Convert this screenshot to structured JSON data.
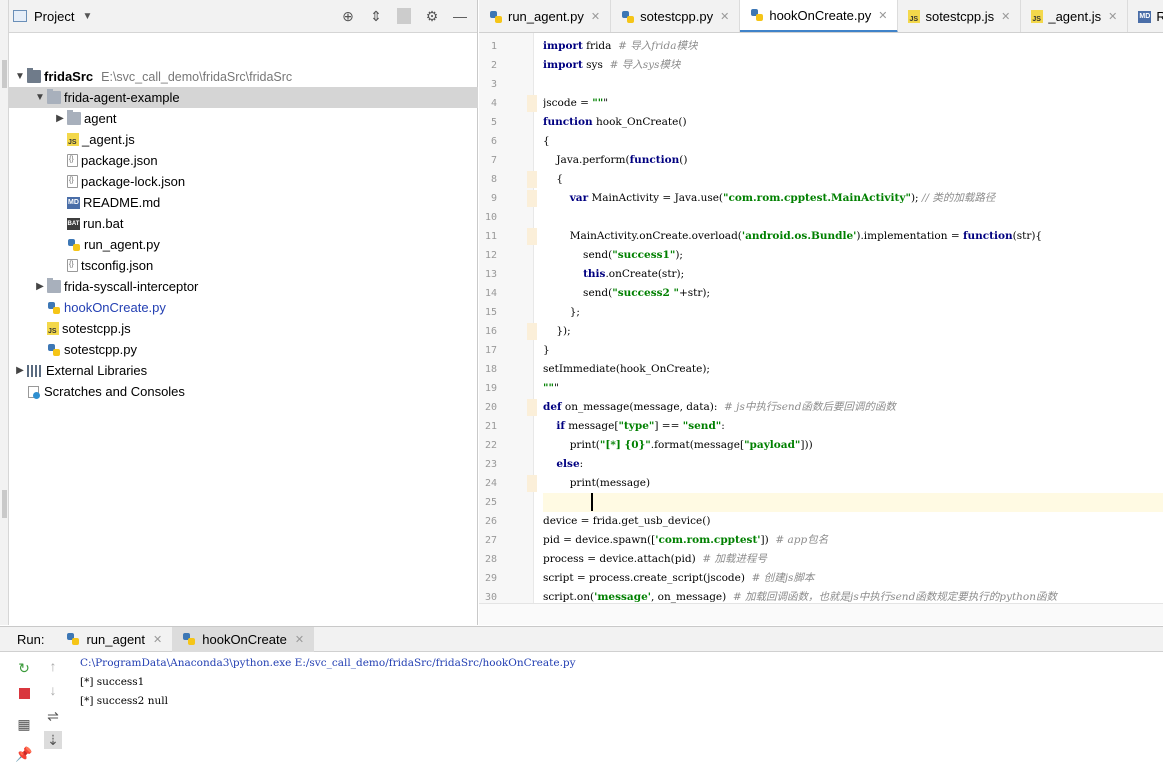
{
  "project": {
    "header_title": "Project",
    "tree": [
      {
        "label": "fridaSrc",
        "path": "E:\\svc_call_demo\\fridaSrc\\fridaSrc",
        "icon": "folder-icon",
        "depth": 0,
        "expanded": true,
        "bold": true
      },
      {
        "label": "frida-agent-example",
        "icon": "folder-icon",
        "depth": 1,
        "expanded": true,
        "selected": true
      },
      {
        "label": "agent",
        "icon": "folder-icon",
        "depth": 2,
        "expanded": false
      },
      {
        "label": "_agent.js",
        "icon": "js-file-icon",
        "depth": 2
      },
      {
        "label": "package.json",
        "icon": "json-file-icon",
        "depth": 2
      },
      {
        "label": "package-lock.json",
        "icon": "json-file-icon",
        "depth": 2
      },
      {
        "label": "README.md",
        "icon": "md-file-icon",
        "depth": 2
      },
      {
        "label": "run.bat",
        "icon": "bat-file-icon",
        "depth": 2
      },
      {
        "label": "run_agent.py",
        "icon": "python-file-icon",
        "depth": 2
      },
      {
        "label": "tsconfig.json",
        "icon": "json-file-icon",
        "depth": 2
      },
      {
        "label": "frida-syscall-interceptor",
        "icon": "folder-icon",
        "depth": 1,
        "expanded": false
      },
      {
        "label": "hookOnCreate.py",
        "icon": "python-file-icon",
        "depth": 1,
        "active": true
      },
      {
        "label": "sotestcpp.js",
        "icon": "js-file-icon",
        "depth": 1
      },
      {
        "label": "sotestcpp.py",
        "icon": "python-file-icon",
        "depth": 1
      },
      {
        "label": "External Libraries",
        "icon": "library-icon",
        "depth": 0,
        "expanded": false
      },
      {
        "label": "Scratches and Consoles",
        "icon": "scratches-icon",
        "depth": 0
      }
    ]
  },
  "editor": {
    "tabs": [
      {
        "label": "run_agent.py",
        "icon": "python-file-icon"
      },
      {
        "label": "sotestcpp.py",
        "icon": "python-file-icon"
      },
      {
        "label": "hookOnCreate.py",
        "icon": "python-file-icon",
        "active": true
      },
      {
        "label": "sotestcpp.js",
        "icon": "js-file-icon"
      },
      {
        "label": "_agent.js",
        "icon": "js-file-icon"
      },
      {
        "label": "README",
        "icon": "md-file-icon"
      }
    ],
    "lines": [
      {
        "n": "1",
        "code": "import frida  # 导入frida模块"
      },
      {
        "n": "2",
        "code": "import sys  # 导入sys模块"
      },
      {
        "n": "3",
        "code": ""
      },
      {
        "n": "4",
        "code": "jscode = \"\"\""
      },
      {
        "n": "5",
        "code": "function hook_OnCreate()"
      },
      {
        "n": "6",
        "code": "{"
      },
      {
        "n": "7",
        "code": "    Java.perform(function()"
      },
      {
        "n": "8",
        "code": "    {"
      },
      {
        "n": "9",
        "code": "        var MainActivity = Java.use(\"com.rom.cpptest.MainActivity\"); // 类的加载路径"
      },
      {
        "n": "10",
        "code": ""
      },
      {
        "n": "11",
        "code": "        MainActivity.onCreate.overload('android.os.Bundle').implementation = function(str){"
      },
      {
        "n": "12",
        "code": "            send(\"success1\");"
      },
      {
        "n": "13",
        "code": "            this.onCreate(str);"
      },
      {
        "n": "14",
        "code": "            send(\"success2 \"+str);"
      },
      {
        "n": "15",
        "code": "        };"
      },
      {
        "n": "16",
        "code": "    });"
      },
      {
        "n": "17",
        "code": "}"
      },
      {
        "n": "18",
        "code": "setImmediate(hook_OnCreate);"
      },
      {
        "n": "19",
        "code": "\"\"\""
      },
      {
        "n": "20",
        "code": "def on_message(message, data):  # js中执行send函数后要回调的函数"
      },
      {
        "n": "21",
        "code": "    if message[\"type\"] == \"send\":"
      },
      {
        "n": "22",
        "code": "        print(\"[*] {0}\".format(message[\"payload\"]))"
      },
      {
        "n": "23",
        "code": "    else:"
      },
      {
        "n": "24",
        "code": "        print(message)"
      },
      {
        "n": "25",
        "code": ""
      },
      {
        "n": "26",
        "code": "device = frida.get_usb_device()"
      },
      {
        "n": "27",
        "code": "pid = device.spawn(['com.rom.cpptest'])  # app包名"
      },
      {
        "n": "28",
        "code": "process = device.attach(pid)  # 加载进程号"
      },
      {
        "n": "29",
        "code": "script = process.create_script(jscode)  # 创建js脚本"
      },
      {
        "n": "30",
        "code": "script.on('message', on_message)  # 加载回调函数，也就是js中执行send函数规定要执行的python函数"
      }
    ]
  },
  "run": {
    "label": "Run:",
    "tabs": [
      {
        "label": "run_agent",
        "icon": "python-file-icon"
      },
      {
        "label": "hookOnCreate",
        "icon": "python-file-icon",
        "active": true
      }
    ],
    "output": [
      "C:\\ProgramData\\Anaconda3\\python.exe E:/svc_call_demo/fridaSrc/fridaSrc/hookOnCreate.py",
      "[*] success1",
      "[*] success2 null"
    ],
    "toolbar": [
      {
        "icon": "rerun-icon"
      },
      {
        "icon": "up-arrow-icon"
      },
      {
        "icon": "stop-icon"
      },
      {
        "icon": "down-arrow-icon"
      },
      {
        "icon": "soft-wrap-icon"
      },
      {
        "icon": "layout-icon"
      },
      {
        "icon": "scroll-end-icon"
      },
      {
        "icon": "pin-icon"
      }
    ]
  },
  "colors": {
    "accent": "#4083c9",
    "selection": "#d5d5d5",
    "active_file": "#2440b3"
  }
}
